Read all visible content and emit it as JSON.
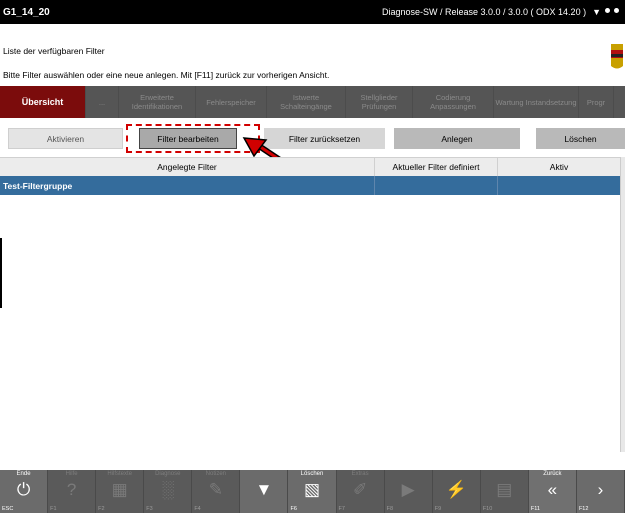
{
  "titlebar": {
    "left": "G1_14_20",
    "right": "Diagnose-SW / Release 3.0.0 / 3.0.0  ( ODX  14.20 )"
  },
  "header": {
    "line1": "Liste der verfügbaren Filter",
    "line2": "Bitte Filter auswählen oder eine neue anlegen. Mit [F11] zurück zur vorherigen Ansicht."
  },
  "nav": {
    "tabs": [
      {
        "label": "Übersicht"
      },
      {
        "label": "..."
      },
      {
        "label": "Erweiterte Identifikationen"
      },
      {
        "label": "Fehlerspeicher"
      },
      {
        "label": "Istwerte Schalteingänge"
      },
      {
        "label": "Stellglieder Prüfungen"
      },
      {
        "label": "Codierung Anpassungen"
      },
      {
        "label": "Wartung Instandsetzung"
      },
      {
        "label": "Progr"
      }
    ]
  },
  "actions": {
    "activate": "Aktivieren",
    "edit": "Filter bearbeiten",
    "reset": "Filter zurücksetzen",
    "create": "Anlegen",
    "delete": "Löschen"
  },
  "table": {
    "columns": [
      "Angelegte Filter",
      "Aktueller Filter definiert",
      "Aktiv"
    ],
    "rows": [
      {
        "name": "Test-Filtergruppe",
        "defined": "",
        "active": ""
      }
    ]
  },
  "fkeys": [
    {
      "label": "Ende",
      "code": "ESC",
      "icon": "power-icon"
    },
    {
      "label": "Hilfe",
      "code": "F1",
      "icon": "help-icon"
    },
    {
      "label": "Hilfstexte",
      "code": "F2",
      "icon": "keyboard-icon"
    },
    {
      "label": "Diagnose",
      "code": "F3",
      "icon": "chart-icon"
    },
    {
      "label": "Notizen",
      "code": "F4",
      "icon": "edit-icon"
    },
    {
      "label": "",
      "code": "",
      "icon": "filter-icon"
    },
    {
      "label": "Löschen",
      "code": "F6",
      "icon": "trash-icon"
    },
    {
      "label": "Extras",
      "code": "F7",
      "icon": "tools-icon"
    },
    {
      "label": "",
      "code": "F8",
      "icon": "play-icon"
    },
    {
      "label": "",
      "code": "F9",
      "icon": "flash-icon"
    },
    {
      "label": "",
      "code": "F10",
      "icon": "document-icon"
    },
    {
      "label": "Zurück",
      "code": "F11",
      "icon": "back-icon"
    },
    {
      "label": "",
      "code": "F12",
      "icon": "next-icon"
    }
  ]
}
